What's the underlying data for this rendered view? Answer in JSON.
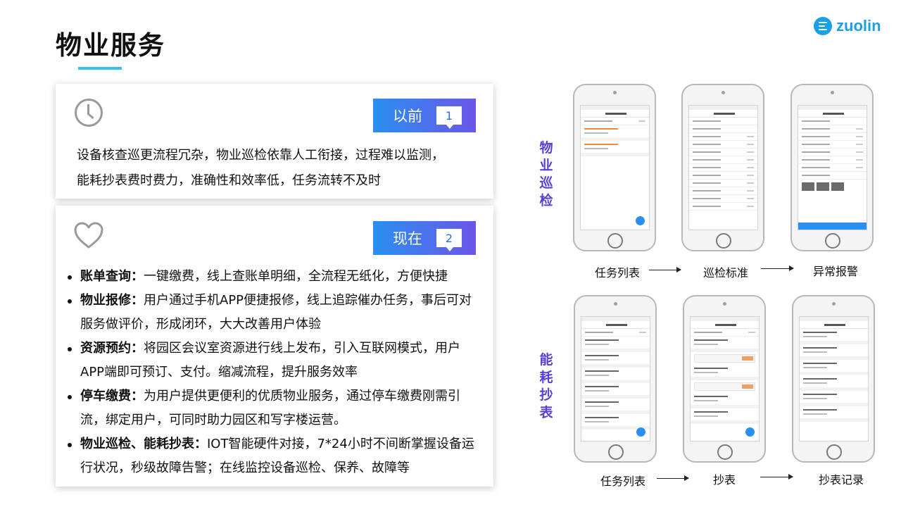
{
  "page": {
    "title": "物业服务",
    "logo_text": "zuolin",
    "accent_color": "#35c3e8",
    "brand_color": "#1aa0e6"
  },
  "before": {
    "tag_label": "以前",
    "tag_number": "1",
    "icon": "clock-icon",
    "text_line1": "设备核查巡更流程冗杂，物业巡检依靠人工衔接，过程难以监测，",
    "text_line2": "能耗抄表费时费力，准确性和效率低，任务流转不及时"
  },
  "now": {
    "tag_label": "现在",
    "tag_number": "2",
    "icon": "heart-icon",
    "items": [
      {
        "title": "账单查询：",
        "line1": "一键缴费，线上查账单明细，全流程无纸化，方便快捷",
        "line2": ""
      },
      {
        "title": "物业报修：",
        "line1": "用户通过手机APP便捷报修，线上追踪催办任务，事后可对",
        "line2": "服务做评价，形成闭环，大大改善用户体验"
      },
      {
        "title": "资源预约：",
        "line1": "将园区会议室资源进行线上发布，引入互联网模式，用户",
        "line2": "APP端即可预订、支付。缩减流程，提升服务效率"
      },
      {
        "title": "停车缴费：",
        "line1": "为用户提供更便利的优质物业服务，通过停车缴费刚需引",
        "line2": "流，绑定用户，可同时助力园区和写字楼运营。"
      },
      {
        "title": "物业巡检、能耗抄表：",
        "line1": "IOT智能硬件对接，7*24小时不间断掌握设备运",
        "line2": "行状况，秒级故障告警；在线监控设备巡检、保养、故障等"
      }
    ]
  },
  "inspection": {
    "label_chars": [
      "物",
      "业",
      "巡",
      "检"
    ],
    "captions": [
      "任务列表",
      "巡检标准",
      "异常报警"
    ]
  },
  "metering": {
    "label_chars": [
      "能",
      "耗",
      "抄",
      "表"
    ],
    "captions": [
      "任务列表",
      "抄表",
      "抄表记录"
    ]
  }
}
